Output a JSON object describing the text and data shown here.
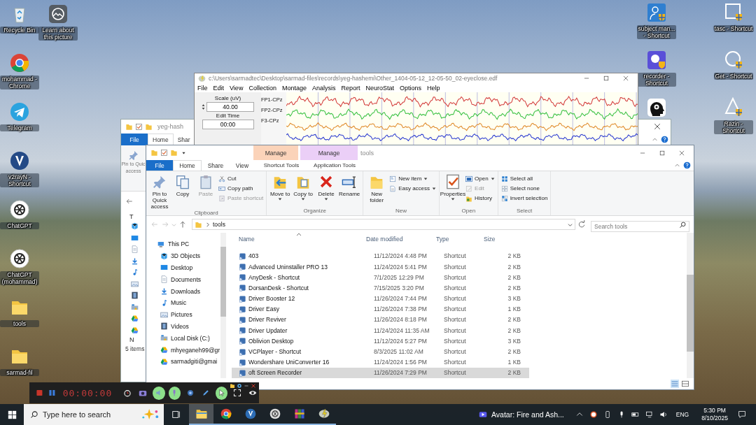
{
  "desktop": {
    "left_columns": [
      [
        {
          "label": "Recycle Bin",
          "kind": "recycle"
        },
        {
          "label": "mohammad - Chrome",
          "kind": "chrome"
        },
        {
          "label": "Telegram",
          "kind": "telegram"
        },
        {
          "label": "v2rayN - Shortcut",
          "kind": "v2ray"
        },
        {
          "label": "ChatGPT",
          "kind": "chatgpt"
        },
        {
          "label": "ChatGPT (mohammad)",
          "kind": "chatgpt"
        },
        {
          "label": "tools",
          "kind": "folder"
        },
        {
          "label": "sarmad-fil",
          "kind": "folder"
        }
      ],
      [
        {
          "label": "Learn about this picture",
          "kind": "picture"
        }
      ]
    ],
    "right_columns": [
      [
        {
          "label": "subject man... - Shortcut",
          "kind": "person"
        },
        {
          "label": "recorder - Shortcut",
          "kind": "recorder"
        },
        {
          "kind": "head"
        }
      ],
      [
        {
          "label": "tasc - Shortcut",
          "kind": "square"
        },
        {
          "label": "Get - Shortcut",
          "kind": "circle"
        },
        {
          "label": "Razin - Shortcut",
          "kind": "triangle"
        }
      ]
    ]
  },
  "back_window": {
    "title": "yeg-hash",
    "tabs": [
      {
        "label": "File",
        "kind": "file",
        "selected": false
      },
      {
        "label": "Home",
        "kind": "plain",
        "selected": true
      },
      {
        "label": "Shar",
        "kind": "plain",
        "selected": false
      }
    ],
    "pin_lines": [
      "Pin to Quic",
      "access"
    ],
    "nav_labels": [
      "T",
      "N"
    ],
    "status": "5 items"
  },
  "eeg_window": {
    "title": "c:\\Users\\sarmadtec\\Desktop\\sarmad-files\\records\\yeg-hashemi\\Other_1404-05-12_12-05-50_02-eyeclose.edf",
    "menu": [
      "File",
      "Edit",
      "View",
      "Collection",
      "Montage",
      "Analysis",
      "Report",
      "NeuroStat",
      "Options",
      "Help"
    ],
    "scale_label": "Scale (uV)",
    "scale_value": "40.00",
    "edit_time_label": "Edit Time",
    "edit_time_value": "00:00",
    "channels": [
      "FP1-CPz",
      "FP2-CPz",
      "F3-CPz"
    ]
  },
  "explorer": {
    "title": "tools",
    "tabs": [
      {
        "label": "File",
        "kind": "file",
        "selected": false
      },
      {
        "label": "Home",
        "kind": "plain",
        "selected": true
      },
      {
        "label": "Share",
        "kind": "plain",
        "selected": false
      },
      {
        "label": "View",
        "kind": "plain",
        "selected": false
      },
      {
        "label": "Shortcut Tools",
        "kind": "context",
        "header": "Manage",
        "color": "#fbd3b9",
        "selected": false
      },
      {
        "label": "Application Tools",
        "kind": "context",
        "header": "Manage",
        "color": "#ebcff7",
        "selected": false
      }
    ],
    "ribbon": [
      {
        "label": "Clipboard",
        "items": [
          {
            "label": "Pin to Quick access",
            "kind": "large",
            "disabled": false
          },
          {
            "label": "Copy",
            "kind": "large",
            "disabled": false
          },
          {
            "label": "Paste",
            "kind": "large",
            "disabled": true
          },
          {
            "label": "Cut",
            "kind": "small",
            "disabled": false
          },
          {
            "label": "Copy path",
            "kind": "small",
            "disabled": false
          },
          {
            "label": "Paste shortcut",
            "kind": "small",
            "disabled": true
          }
        ]
      },
      {
        "label": "Organize",
        "items": [
          {
            "label": "Move to",
            "kind": "large-menu",
            "disabled": false
          },
          {
            "label": "Copy to",
            "kind": "large-menu",
            "disabled": false
          },
          {
            "label": "Delete",
            "kind": "large-menu",
            "disabled": false
          },
          {
            "label": "Rename",
            "kind": "large",
            "disabled": false
          }
        ]
      },
      {
        "label": "New",
        "items": [
          {
            "label": "New folder",
            "kind": "large",
            "disabled": false
          },
          {
            "label": "New item",
            "kind": "small-menu",
            "disabled": false
          },
          {
            "label": "Easy access",
            "kind": "small-menu",
            "disabled": false
          }
        ]
      },
      {
        "label": "Open",
        "items": [
          {
            "label": "Properties",
            "kind": "large-menu",
            "disabled": false
          },
          {
            "label": "Open",
            "kind": "small-menu",
            "disabled": false
          },
          {
            "label": "Edit",
            "kind": "small",
            "disabled": true
          },
          {
            "label": "History",
            "kind": "small",
            "disabled": false
          }
        ]
      },
      {
        "label": "Select",
        "items": [
          {
            "label": "Select all",
            "kind": "small",
            "disabled": false
          },
          {
            "label": "Select none",
            "kind": "small",
            "disabled": false
          },
          {
            "label": "Invert selection",
            "kind": "small",
            "disabled": false
          }
        ]
      }
    ],
    "address": "tools",
    "search": {
      "placeholder": "Search tools"
    },
    "tree": [
      {
        "label": "This PC",
        "kind": "pc",
        "children": [
          {
            "label": "3D Objects",
            "kind": "cube"
          },
          {
            "label": "Desktop",
            "kind": "desktop"
          },
          {
            "label": "Documents",
            "kind": "documents"
          },
          {
            "label": "Downloads",
            "kind": "downloads"
          },
          {
            "label": "Music",
            "kind": "music"
          },
          {
            "label": "Pictures",
            "kind": "pictures"
          },
          {
            "label": "Videos",
            "kind": "videos"
          },
          {
            "label": "Local Disk (C:)",
            "kind": "drive"
          },
          {
            "label": "mhyeganeh99@gr",
            "kind": "cloud"
          },
          {
            "label": "sarmadgiti@gmai",
            "kind": "cloud"
          }
        ]
      }
    ],
    "columns": [
      "Name",
      "Date modified",
      "Type",
      "Size"
    ],
    "rows": [
      {
        "name": "403",
        "date": "11/12/2024 4:48 PM",
        "type": "Shortcut",
        "size": "2 KB",
        "selected": false
      },
      {
        "name": "Advanced Uninstaller PRO 13",
        "date": "11/24/2024 5:41 PM",
        "type": "Shortcut",
        "size": "2 KB",
        "selected": false
      },
      {
        "name": "AnyDesk - Shortcut",
        "date": "7/1/2025 12:29 PM",
        "type": "Shortcut",
        "size": "2 KB",
        "selected": false
      },
      {
        "name": "DorsanDesk - Shortcut",
        "date": "7/15/2025 3:20 PM",
        "type": "Shortcut",
        "size": "2 KB",
        "selected": false
      },
      {
        "name": "Driver Booster 12",
        "date": "11/26/2024 7:44 PM",
        "type": "Shortcut",
        "size": "3 KB",
        "selected": false
      },
      {
        "name": "Driver Easy",
        "date": "11/26/2024 7:38 PM",
        "type": "Shortcut",
        "size": "1 KB",
        "selected": false
      },
      {
        "name": "Driver Reviver",
        "date": "11/26/2024 8:18 PM",
        "type": "Shortcut",
        "size": "2 KB",
        "selected": false
      },
      {
        "name": "Driver Updater",
        "date": "11/24/2024 11:35 AM",
        "type": "Shortcut",
        "size": "2 KB",
        "selected": false
      },
      {
        "name": "Oblivion Desktop",
        "date": "11/12/2024 5:27 PM",
        "type": "Shortcut",
        "size": "3 KB",
        "selected": false
      },
      {
        "name": "VCPlayer - Shortcut",
        "date": "8/3/2025 11:02 AM",
        "type": "Shortcut",
        "size": "2 KB",
        "selected": false
      },
      {
        "name": "Wondershare UniConverter 16",
        "date": "11/24/2024 1:56 PM",
        "type": "Shortcut",
        "size": "1 KB",
        "selected": false
      },
      {
        "name": "oft Screen Recorder",
        "date": "11/26/2024 7:29 PM",
        "type": "Shortcut",
        "size": "2 KB",
        "selected": true
      }
    ]
  },
  "recorder": {
    "timer": "00:00:00",
    "tools": [
      {
        "kind": "alarm",
        "on": false
      },
      {
        "kind": "camera",
        "on": false
      },
      {
        "kind": "speaker",
        "on": true
      },
      {
        "kind": "mic",
        "on": true
      },
      {
        "kind": "webcam",
        "on": false
      },
      {
        "kind": "pen",
        "on": false
      },
      {
        "kind": "cursor",
        "on": true
      },
      {
        "kind": "fullscreen",
        "on": false
      },
      {
        "kind": "eye",
        "on": false
      }
    ]
  },
  "taskbar": {
    "search": {
      "placeholder": "Type here to search"
    },
    "apps": [
      {
        "kind": "explorer",
        "selected": true
      },
      {
        "kind": "chrome",
        "selected": false
      },
      {
        "kind": "v2ray",
        "selected": false
      },
      {
        "kind": "chatgpt",
        "selected": false
      },
      {
        "kind": "winrar",
        "selected": false
      },
      {
        "kind": "eeg",
        "selected": false
      }
    ],
    "media": "Avatar: Fire and Ash...",
    "language": "ENG",
    "time": "5:30 PM",
    "date": "8/10/2025"
  }
}
